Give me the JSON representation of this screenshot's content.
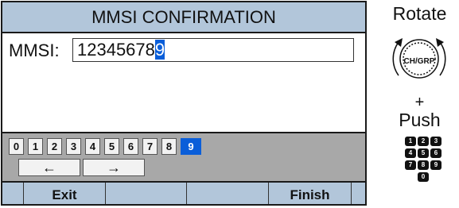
{
  "screen": {
    "title": "MMSI CONFIRMATION",
    "mmsi_label": "MMSI:",
    "mmsi_value_prefix": "12345678",
    "mmsi_value_cursor": "9",
    "digit_keys": [
      "0",
      "1",
      "2",
      "3",
      "4",
      "5",
      "6",
      "7",
      "8",
      "9"
    ],
    "selected_digit": "9",
    "arrow_left": "←",
    "arrow_right": "→",
    "softkeys": [
      "Exit",
      "",
      "",
      "Finish"
    ]
  },
  "side": {
    "rotate_label": "Rotate",
    "knob_label": "CH/GRP",
    "plus_label": "+",
    "push_label": "Push",
    "mini_keypad": [
      "1",
      "2",
      "3",
      "4",
      "5",
      "6",
      "7",
      "8",
      "9",
      "0"
    ]
  },
  "colors": {
    "title_bar": "#b2c6da",
    "keypad_area": "#a8a8a8",
    "selection": "#0a5ed9"
  }
}
